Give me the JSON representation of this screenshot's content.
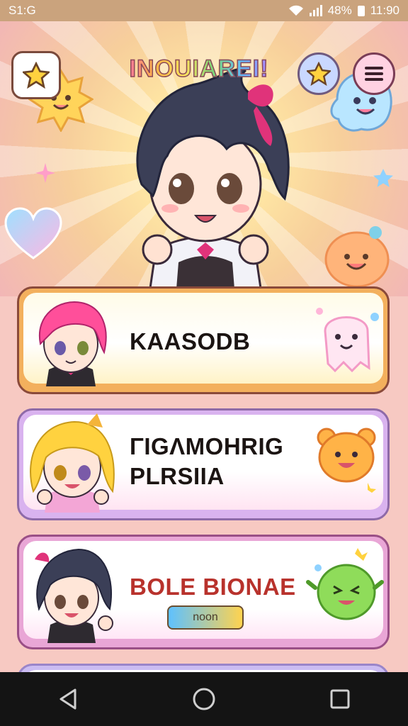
{
  "status_bar": {
    "carrier": "S1:G",
    "battery_percent": "48%",
    "time": "11:90"
  },
  "header": {
    "title": "INOUIAREI!",
    "star_icon": "star-icon",
    "favorite_icon": "star-badge-icon",
    "menu_icon": "hamburger-menu-icon"
  },
  "cards": [
    {
      "name": "KAASODB",
      "accent": "#f3b05d"
    },
    {
      "name_line1": "ΓIGΛMOHRIG",
      "name_line2": "PLRSIIA",
      "accent": "#d9b3ef"
    },
    {
      "name": "BOLE BIONAE",
      "button_label": "noon",
      "accent": "#e9a6d6"
    }
  ],
  "colors": {
    "status_bar": "#caa37d",
    "content_bg": "#f7c9c2",
    "nav_bar": "#141414"
  },
  "nav": {
    "back_icon": "back-triangle-icon",
    "home_icon": "home-circle-icon",
    "recents_icon": "recents-square-icon"
  }
}
